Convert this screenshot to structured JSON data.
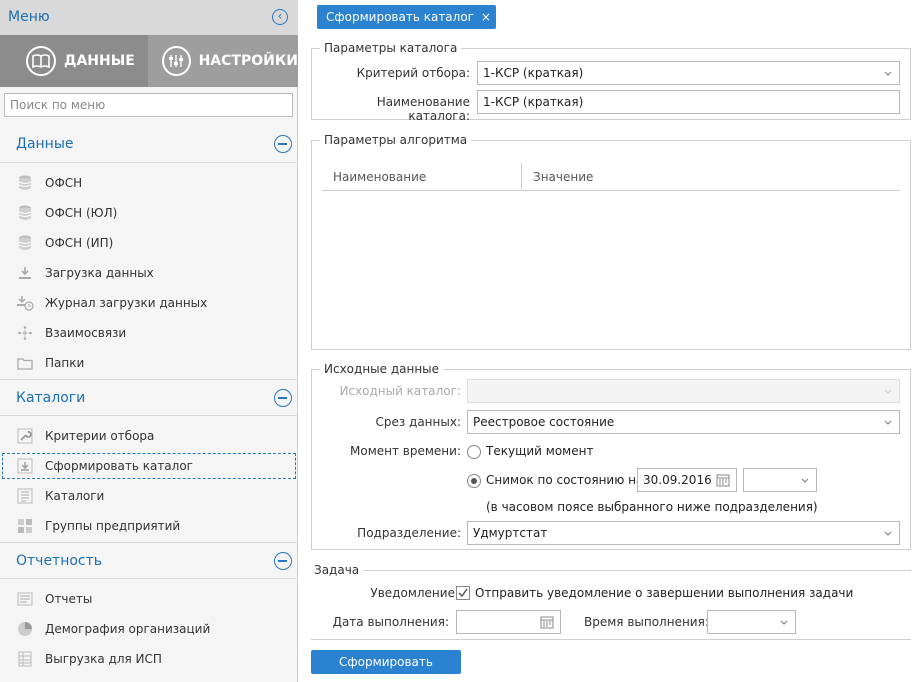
{
  "sidebar": {
    "title": "Меню",
    "tabs": [
      {
        "label": "ДАННЫЕ"
      },
      {
        "label": "НАСТРОЙКИ"
      }
    ],
    "search_placeholder": "Поиск по меню",
    "sections": [
      {
        "label": "Данные",
        "items": [
          {
            "label": "ОФСН",
            "icon": "database-icon"
          },
          {
            "label": "ОФСН (ЮЛ)",
            "icon": "database-icon"
          },
          {
            "label": "ОФСН (ИП)",
            "icon": "database-icon"
          },
          {
            "label": "Загрузка данных",
            "icon": "download-icon"
          },
          {
            "label": "Журнал загрузки данных",
            "icon": "download-clock-icon"
          },
          {
            "label": "Взаимосвязи",
            "icon": "network-icon"
          },
          {
            "label": "Папки",
            "icon": "folder-icon"
          }
        ]
      },
      {
        "label": "Каталоги",
        "items": [
          {
            "label": "Критерии отбора",
            "icon": "wrench-icon"
          },
          {
            "label": "Сформировать каталог",
            "icon": "export-icon"
          },
          {
            "label": "Каталоги",
            "icon": "catalog-icon"
          },
          {
            "label": "Группы предприятий",
            "icon": "group-icon"
          }
        ]
      },
      {
        "label": "Отчетность",
        "items": [
          {
            "label": "Отчеты",
            "icon": "report-icon"
          },
          {
            "label": "Демография организаций",
            "icon": "pie-chart-icon"
          },
          {
            "label": "Выгрузка для ИСП",
            "icon": "table-icon"
          }
        ]
      }
    ]
  },
  "main": {
    "tab_label": "Сформировать каталог",
    "tab_close": "×",
    "catalog_params": {
      "legend": "Параметры каталога",
      "criterion_label": "Критерий отбора:",
      "criterion_value": "1-КСР (краткая)",
      "name_label": "Наименование каталога:",
      "name_value": "1-КСР (краткая)"
    },
    "algo_params": {
      "legend": "Параметры алгоритма",
      "columns": [
        "Наименование",
        "Значение"
      ]
    },
    "source": {
      "legend": "Исходные данные",
      "src_catalog_label": "Исходный каталог:",
      "src_catalog_value": "",
      "slice_label": "Срез данных:",
      "slice_value": "Реестровое состояние",
      "moment_label": "Момент времени:",
      "radio_current": "Текущий момент",
      "radio_snapshot": "Снимок по состоянию на",
      "snapshot_date": "30.09.2016",
      "snapshot_time": "",
      "timezone_note": "(в часовом поясе выбранного ниже подразделения)",
      "division_label": "Подразделение:",
      "division_value": "Удмуртстат"
    },
    "task": {
      "legend": "Задача",
      "notify_label": "Уведомление:",
      "notify_text": "Отправить уведомление о завершении выполнения задачи",
      "date_label": "Дата выполнения:",
      "date_value": "",
      "time_label": "Время выполнения:",
      "time_value": ""
    },
    "submit_label": "Сформировать"
  },
  "colors": {
    "accent": "#2a82d0",
    "sidebar_link": "#1c6fb5",
    "sidebar_tabs_bg": "#9e9e9e"
  }
}
